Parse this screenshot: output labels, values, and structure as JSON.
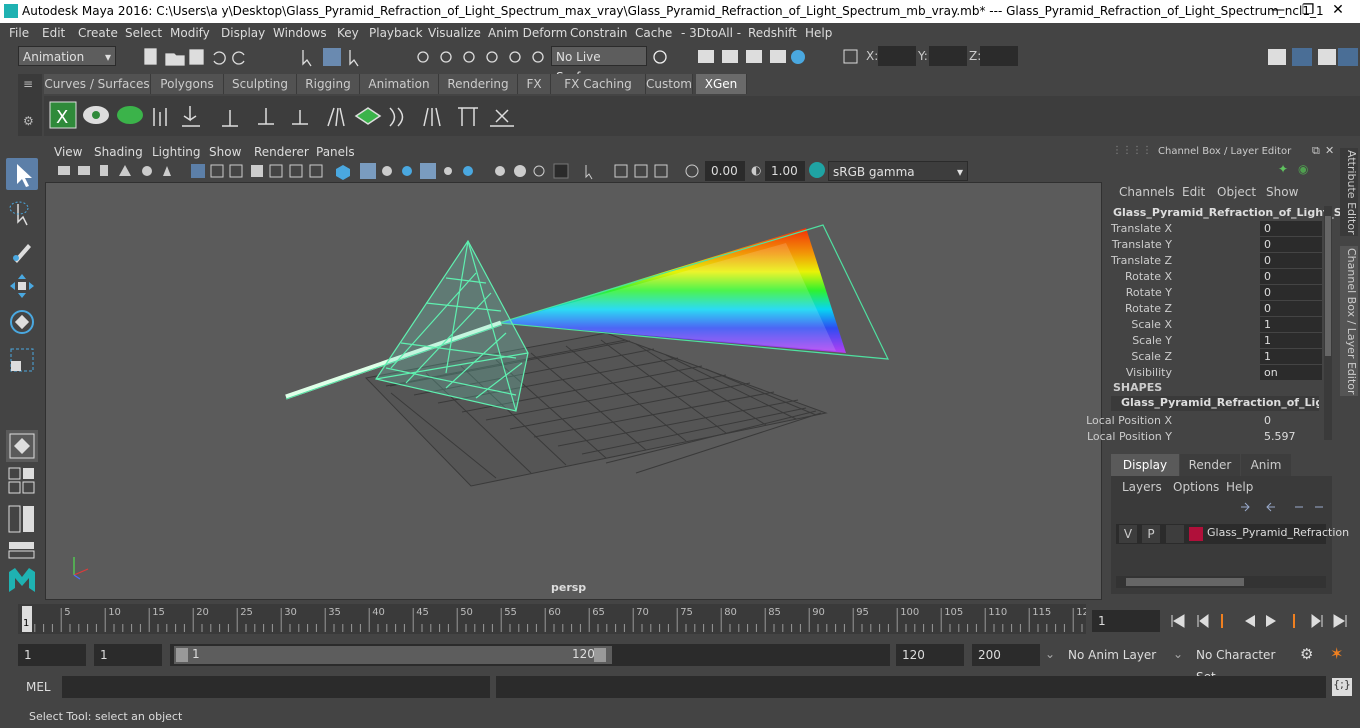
{
  "window": {
    "title": "Autodesk Maya 2016: C:\\Users\\a y\\Desktop\\Glass_Pyramid_Refraction_of_Light_Spectrum_max_vray\\Glass_Pyramid_Refraction_of_Light_Spectrum_mb_vray.mb*   ---   Glass_Pyramid_Refraction_of_Light_Spectrum_ncl1_1",
    "minimize": "—",
    "maximize": "❐",
    "close": "✕"
  },
  "menubar": [
    "File",
    "Edit",
    "Create",
    "Select",
    "Modify",
    "Display",
    "Windows",
    "Key",
    "Playback",
    "Visualize",
    "Anim Deform",
    "Constrain",
    "Cache",
    "- 3DtoAll -",
    "Redshift",
    "Help"
  ],
  "status": {
    "menuset": "Animation",
    "live_surface": "No Live Surface",
    "x_label": "X:",
    "y_label": "Y:",
    "z_label": "Z:"
  },
  "shelf_tabs": [
    "Curves / Surfaces",
    "Polygons",
    "Sculpting",
    "Rigging",
    "Animation",
    "Rendering",
    "FX",
    "FX Caching",
    "Custom",
    "XGen"
  ],
  "active_shelf": "XGen",
  "viewport": {
    "menus": [
      "View",
      "Shading",
      "Lighting",
      "Show",
      "Renderer",
      "Panels"
    ],
    "exposure": "0.00",
    "gamma": "1.00",
    "colorspace": "sRGB gamma",
    "camera_label": "persp"
  },
  "channel_box": {
    "header": "Channel Box / Layer Editor",
    "menus": [
      "Channels",
      "Edit",
      "Object",
      "Show"
    ],
    "object_name": "Glass_Pyramid_Refraction_of_Light_S...",
    "channels": [
      {
        "label": "Translate X",
        "value": "0"
      },
      {
        "label": "Translate Y",
        "value": "0"
      },
      {
        "label": "Translate Z",
        "value": "0"
      },
      {
        "label": "Rotate X",
        "value": "0"
      },
      {
        "label": "Rotate Y",
        "value": "0"
      },
      {
        "label": "Rotate Z",
        "value": "0"
      },
      {
        "label": "Scale X",
        "value": "1"
      },
      {
        "label": "Scale Y",
        "value": "1"
      },
      {
        "label": "Scale Z",
        "value": "1"
      },
      {
        "label": "Visibility",
        "value": "on"
      }
    ],
    "shapes_label": "SHAPES",
    "shape_name": "Glass_Pyramid_Refraction_of_Light_...",
    "shape_channels": [
      {
        "label": "Local Position X",
        "value": "0"
      },
      {
        "label": "Local Position Y",
        "value": "5.597"
      }
    ]
  },
  "layer_editor": {
    "tabs": [
      "Display",
      "Render",
      "Anim"
    ],
    "menus": [
      "Layers",
      "Options",
      "Help"
    ],
    "layer": {
      "v": "V",
      "p": "P",
      "name": "Glass_Pyramid_Refraction",
      "color": "#b0103a"
    }
  },
  "side_tabs": [
    "Attribute Editor",
    "Channel Box / Layer Editor"
  ],
  "timeline": {
    "ticks": [
      "5",
      "10",
      "15",
      "20",
      "25",
      "30",
      "35",
      "40",
      "45",
      "50",
      "55",
      "60",
      "65",
      "70",
      "75",
      "80",
      "85",
      "90",
      "95",
      "100",
      "105",
      "110",
      "115",
      "12"
    ],
    "current_frame_marker": "1",
    "current_frame": "1"
  },
  "range": {
    "start": "1",
    "playback_start": "1",
    "slider_start": "1",
    "slider_end": "120",
    "playback_end": "120",
    "end": "200",
    "anim_layer": "No Anim Layer",
    "character_set": "No Character Set"
  },
  "command": {
    "label": "MEL"
  },
  "help_line": "Select Tool: select an object"
}
